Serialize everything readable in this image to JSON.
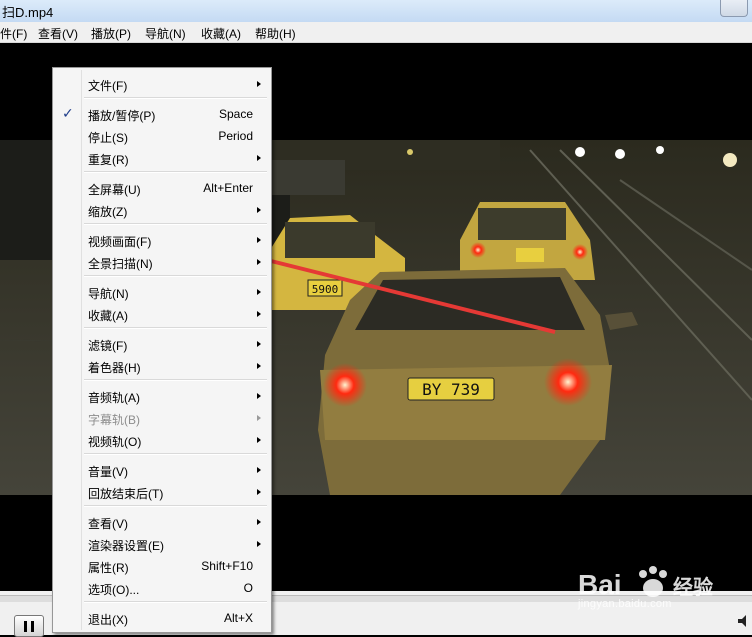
{
  "window": {
    "title": "扫D.mp4"
  },
  "menubar": {
    "items": [
      "件(F)",
      "查看(V)",
      "播放(P)",
      "导航(N)",
      "收藏(A)",
      "帮助(H)"
    ]
  },
  "context_menu": {
    "groups": [
      [
        {
          "label": "文件(F)",
          "submenu": true
        }
      ],
      [
        {
          "label": "播放/暂停(P)",
          "shortcut": "Space",
          "checked": true
        },
        {
          "label": "停止(S)",
          "shortcut": "Period"
        },
        {
          "label": "重复(R)",
          "submenu": true
        }
      ],
      [
        {
          "label": "全屏幕(U)",
          "shortcut": "Alt+Enter"
        },
        {
          "label": "缩放(Z)",
          "submenu": true
        }
      ],
      [
        {
          "label": "视频画面(F)",
          "submenu": true
        },
        {
          "label": "全景扫描(N)",
          "submenu": true
        }
      ],
      [
        {
          "label": "导航(N)",
          "submenu": true
        },
        {
          "label": "收藏(A)",
          "submenu": true
        }
      ],
      [
        {
          "label": "滤镜(F)",
          "submenu": true
        },
        {
          "label": "着色器(H)",
          "submenu": true
        }
      ],
      [
        {
          "label": "音频轨(A)",
          "submenu": true
        },
        {
          "label": "字幕轨(B)",
          "submenu": true,
          "disabled": true
        },
        {
          "label": "视频轨(O)",
          "submenu": true
        }
      ],
      [
        {
          "label": "音量(V)",
          "submenu": true
        },
        {
          "label": "回放结束后(T)",
          "submenu": true
        }
      ],
      [
        {
          "label": "查看(V)",
          "submenu": true
        },
        {
          "label": "渲染器设置(E)",
          "submenu": true
        },
        {
          "label": "属性(R)",
          "shortcut": "Shift+F10"
        },
        {
          "label": "选项(O)...",
          "shortcut": "O"
        }
      ],
      [
        {
          "label": "退出(X)",
          "shortcut": "Alt+X"
        }
      ]
    ]
  },
  "video": {
    "plate_front": "BY 739",
    "plate_mid": "5900"
  },
  "watermark": {
    "brand": "Bai",
    "brand_cn": "经验",
    "url": "jingyan.baidu.com"
  },
  "colors": {
    "annotation_arrow": "#e53935",
    "check": "#1f3d8a"
  }
}
